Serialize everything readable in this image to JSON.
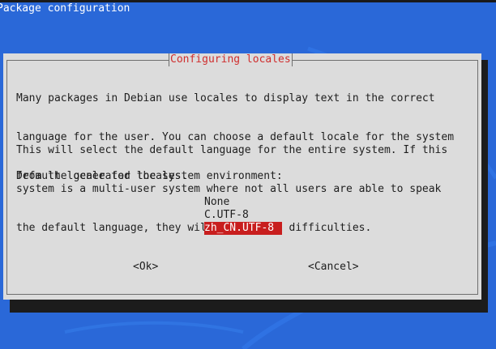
{
  "backtitle": "Package configuration",
  "dialog": {
    "title": "Configuring locales",
    "paragraph1": [
      "Many packages in Debian use locales to display text in the correct",
      "language for the user. You can choose a default locale for the system",
      "from the generated locales."
    ],
    "paragraph2": [
      "This will select the default language for the entire system. If this",
      "system is a multi-user system where not all users are able to speak",
      "the default language, they will experience difficulties."
    ],
    "prompt": "Default locale for the system environment:",
    "options": [
      "None",
      "C.UTF-8",
      "zh_CN.UTF-8"
    ],
    "selected_option": "zh_CN.UTF-8",
    "ok_label": "<Ok>",
    "cancel_label": "<Cancel>"
  },
  "colors": {
    "background": "#2a68d8",
    "dialog": "#dcdcdc",
    "title": "#cf2e2e",
    "selection": "#c81e1e",
    "shadow": "#1c1c1c"
  }
}
